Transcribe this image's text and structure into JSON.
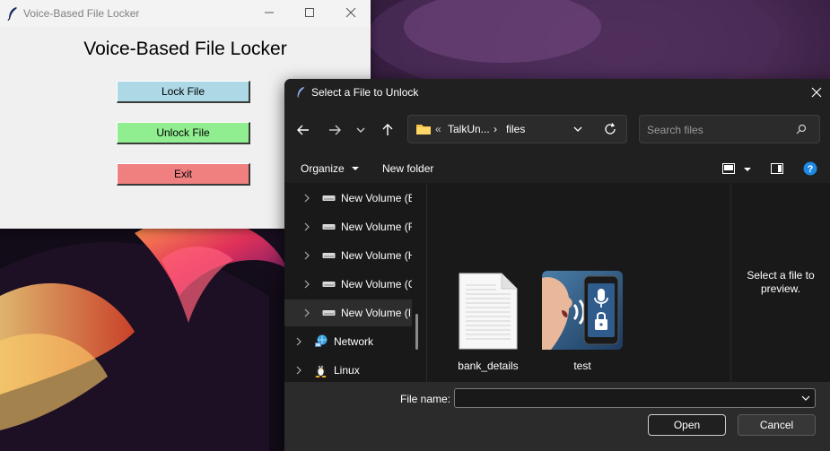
{
  "app": {
    "title": "Voice-Based File Locker",
    "heading": "Voice-Based File Locker",
    "buttons": [
      {
        "label": "Lock File",
        "color": "#add8e6"
      },
      {
        "label": "Unlock File",
        "color": "#90ee90"
      },
      {
        "label": "Exit",
        "color": "#f08080"
      }
    ]
  },
  "dialog": {
    "title": "Select a File to Unlock",
    "address": {
      "prefix": "«",
      "segment1": "TalkUn...",
      "separator": "›",
      "segment2": "files"
    },
    "search_placeholder": "Search files",
    "toolbar": {
      "organize": "Organize",
      "new_folder": "New folder"
    },
    "nav_items": [
      {
        "label": "New Volume (E",
        "icon": "drive-icon",
        "selected": false
      },
      {
        "label": "New Volume (F",
        "icon": "drive-icon",
        "selected": false
      },
      {
        "label": "New Volume (H",
        "icon": "drive-icon",
        "selected": false
      },
      {
        "label": "New Volume (G",
        "icon": "drive-icon",
        "selected": false
      },
      {
        "label": "New Volume (I",
        "icon": "drive-icon",
        "selected": true
      },
      {
        "label": "Network",
        "icon": "network-icon",
        "selected": false
      },
      {
        "label": "Linux",
        "icon": "linux-icon",
        "selected": false
      }
    ],
    "files": [
      {
        "name": "bank_details",
        "icon": "document-icon"
      },
      {
        "name": "test",
        "icon": "voice-lock-image-icon"
      }
    ],
    "preview_text": "Select a file to preview.",
    "file_name_label": "File name:",
    "file_name_value": "",
    "open_label": "Open",
    "cancel_label": "Cancel"
  },
  "colors": {
    "accent": "#1e88e5",
    "dialog_bg": "#202020"
  }
}
